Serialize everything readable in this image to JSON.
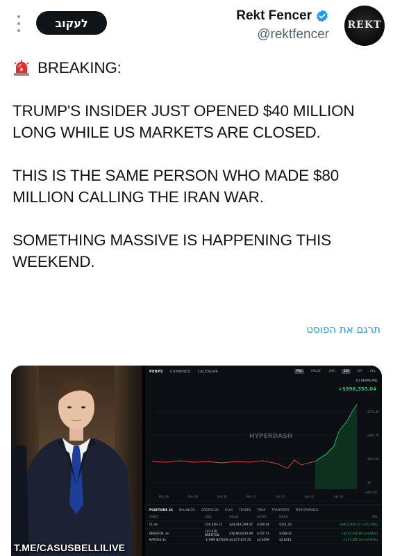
{
  "header": {
    "follow_label": "לעקוב",
    "display_name": "Rekt Fencer",
    "handle": "@rektfencer",
    "avatar_text": "REKT"
  },
  "post": {
    "breaking": "BREAKING:",
    "para1": "TRUMP'S INSIDER JUST OPENED  $40 MILLION LONG WHILE US MARKETS ARE CLOSED.",
    "para2": "THIS IS THE SAME PERSON WHO MADE $80 MILLION CALLING THE IRAN WAR.",
    "para3": "SOMETHING MASSIVE IS HAPPENING THIS WEEKEND.",
    "translate_label": "תרגם את הפוסט"
  },
  "media": {
    "watermark": "T.ME/CASUSBELLILIVE"
  },
  "dashboard": {
    "tabs": [
      "PERPS",
      "COMBINED",
      "CALENDAR"
    ],
    "right_tabs": [
      "PNL",
      "VALUE",
      "24H",
      "1W",
      "1M",
      "ALL"
    ],
    "pnl_label": "7D PERPS PNL",
    "pnl_value": "+$996,355.04",
    "brand": "HYPERDASH",
    "x_labels": [
      "Mar 28",
      "Mar 29",
      "Mar 30",
      "Mar 31",
      "Apr 01",
      "Apr 02",
      "Apr 03"
    ],
    "y_labels": [
      "$735.4K",
      "$490.7K",
      "$245.9K",
      "$0",
      "-$307.6K"
    ],
    "position_tabs": [
      "POSITIONS 26",
      "BALANCES",
      "ORDERS 26",
      "FILLS",
      "TRADES",
      "TWAP",
      "TRANSFERS",
      "PERFORMANCE"
    ],
    "position_headers": [
      "ASSET",
      "SIZE",
      "VALUE",
      "ENTRY",
      "MARK",
      "PNL"
    ],
    "rows": [
      {
        "asset": "CL 4x",
        "size": "319.5AH CL",
        "value": "$24,414,299.47",
        "entry": "$108.18",
        "mark": "$111.30",
        "pnl": "+$872,935.47 (+11.35%)"
      },
      {
        "asset": "BRENTOIL 3x",
        "size": "143.67K BRENTOIL",
        "value": "$16,863,870.99",
        "entry": "$107.73",
        "mark": "$108.03",
        "pnl": "+$137,142.96 (+4.81%)"
      },
      {
        "asset": "NATGAS 3x",
        "size": "-1.99M NATGAS",
        "value": "$4,677,657.25",
        "entry": "$2.9599",
        "mark": "$2.8112",
        "pnl": "+$77,195.14 (+4.97%)"
      }
    ]
  },
  "colors": {
    "follow_bg": "#0f1419",
    "verified": "#1d9bf0",
    "translate": "#1d9bf0",
    "pnl_green": "#22c55e",
    "loss_red": "#ef4444"
  }
}
